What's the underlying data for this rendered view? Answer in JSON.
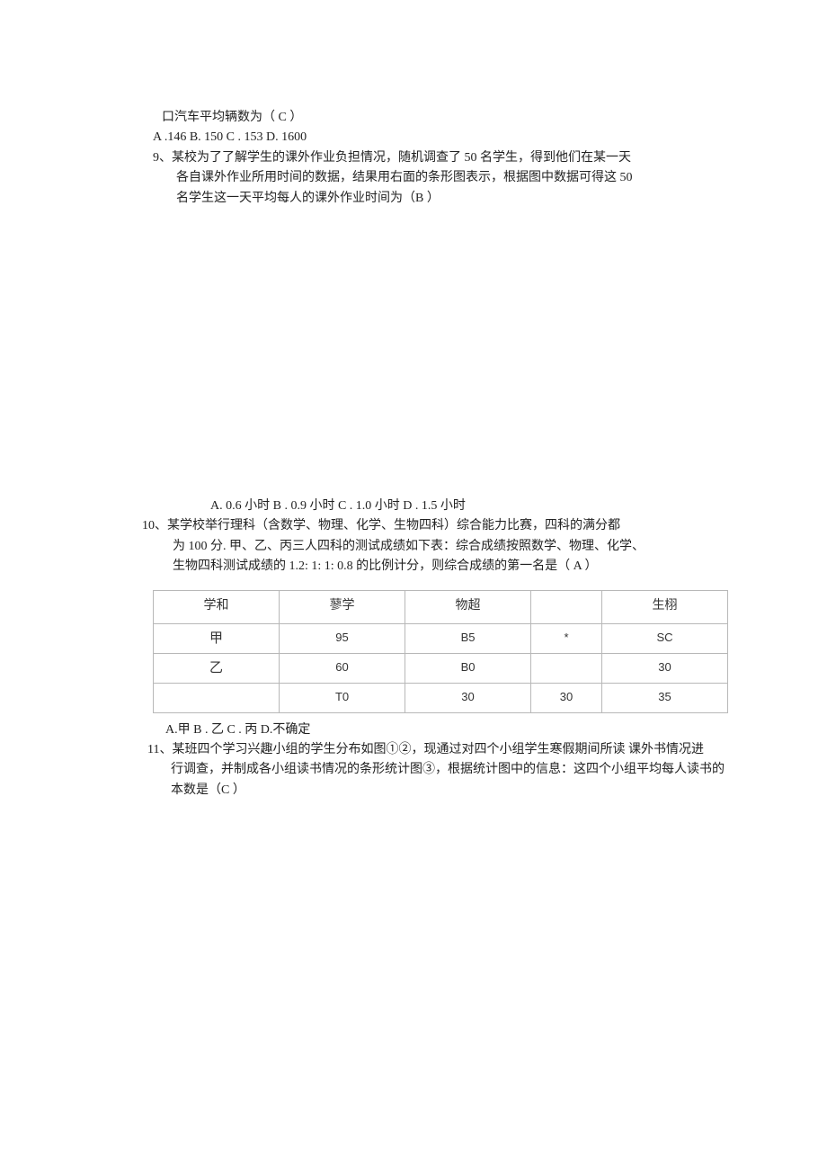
{
  "q8": {
    "tail": "口汽车平均辆数为（ C ）",
    "opts": "A .146 B. 150 C . 153 D. 1600"
  },
  "q9": {
    "head": "9、某校为了了解学生的课外作业负担情况，随机调查了 50 名学生，得到他们在某一天",
    "body1": "各自课外作业所用时间的数据，结果用右面的条形图表示，根据图中数据可得这 50",
    "body2": "名学生这一天平均每人的课外作业时间为（B ）",
    "opts": "A. 0.6 小时  B . 0.9 小时  C . 1.0 小时  D . 1.5 小时"
  },
  "q10": {
    "head": "10、某学校举行理科（含数学、物理、化学、生物四科）综合能力比赛，四科的满分都",
    "body1": "为 100 分. 甲、乙、丙三人四科的测试成绩如下表：综合成绩按照数学、物理、化学、",
    "body2": "生物四科测试成绩的 1.2: 1: 1: 0.8 的比例计分，则综合成绩的第一名是（ A ）",
    "ans": "A.甲 B . 乙 C . 丙 D.不确定",
    "table": {
      "header": [
        "学和",
        "蓼学",
        "物超",
        "",
        "生栩"
      ],
      "rows": [
        [
          "甲",
          "95",
          "B5",
          "*",
          "SC"
        ],
        [
          "乙",
          "60",
          "B0",
          "",
          "30"
        ],
        [
          "",
          "T0",
          "30",
          "30",
          "35"
        ]
      ]
    }
  },
  "q11": {
    "head": "11、某班四个学习兴趣小组的学生分布如图①②，现通过对四个小组学生寒假期间所读 课外书情况进",
    "body1": "行调查，并制成各小组读书情况的条形统计图③，根据统计图中的信息：这四个小组平均每人读书的",
    "body2": "本数是（C ）"
  }
}
